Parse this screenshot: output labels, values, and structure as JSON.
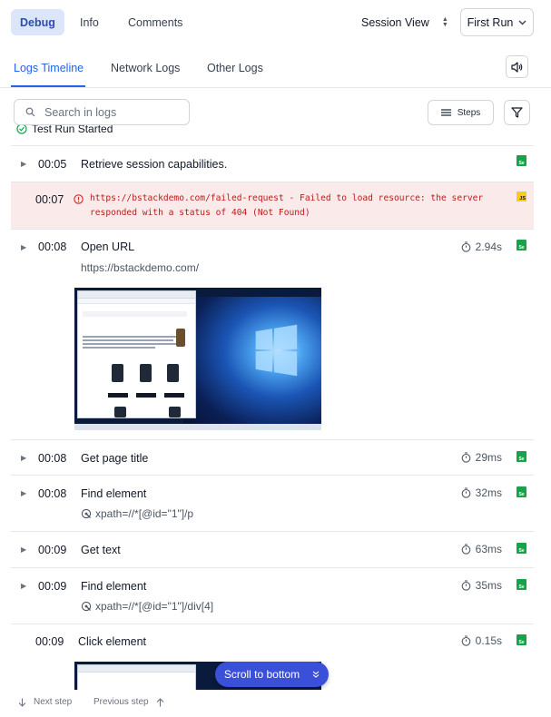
{
  "top_tabs": [
    {
      "label": "Debug",
      "active": true
    },
    {
      "label": "Info",
      "active": false
    },
    {
      "label": "Comments",
      "active": false
    }
  ],
  "session_view": {
    "label": "Session View"
  },
  "run_select": {
    "value": "First Run"
  },
  "sub_tabs": [
    {
      "label": "Logs Timeline",
      "active": true
    },
    {
      "label": "Network Logs",
      "active": false
    },
    {
      "label": "Other Logs",
      "active": false
    }
  ],
  "toolbar": {
    "search_placeholder": "Search in logs",
    "steps_label": "Steps"
  },
  "test_started": "Test Run Started",
  "logs": [
    {
      "time": "00:05",
      "label": "Retrieve session capabilities.",
      "badge": "selenium-icon"
    },
    {
      "time": "00:07",
      "type": "error",
      "text": "https://bstackdemo.com/failed-request - Failed to load resource: the server responded with a status of 404 (Not Found)",
      "badge": "JS"
    },
    {
      "time": "00:08",
      "label": "Open URL",
      "detail": "https://bstackdemo.com/",
      "duration": "2.94s",
      "screenshot": true
    },
    {
      "time": "00:08",
      "label": "Get page title",
      "duration": "29ms"
    },
    {
      "time": "00:08",
      "label": "Find element",
      "detail": "xpath=//*[@id=\"1\"]/p",
      "duration": "32ms"
    },
    {
      "time": "00:09",
      "label": "Get text",
      "duration": "63ms"
    },
    {
      "time": "00:09",
      "label": "Find element",
      "detail": "xpath=//*[@id=\"1\"]/div[4]",
      "duration": "35ms"
    },
    {
      "time": "00:09",
      "label": "Click element",
      "duration": "0.15s",
      "screenshot": true
    }
  ],
  "scroll_button": {
    "label": "Scroll to bottom"
  },
  "footer": {
    "next": "Next step",
    "previous": "Previous step"
  },
  "colors": {
    "accent": "#2563eb",
    "error_bg": "#fbeaea",
    "error_text": "#b91c1c",
    "success": "#16a34a",
    "scroll_btn": "#3b50d8"
  }
}
